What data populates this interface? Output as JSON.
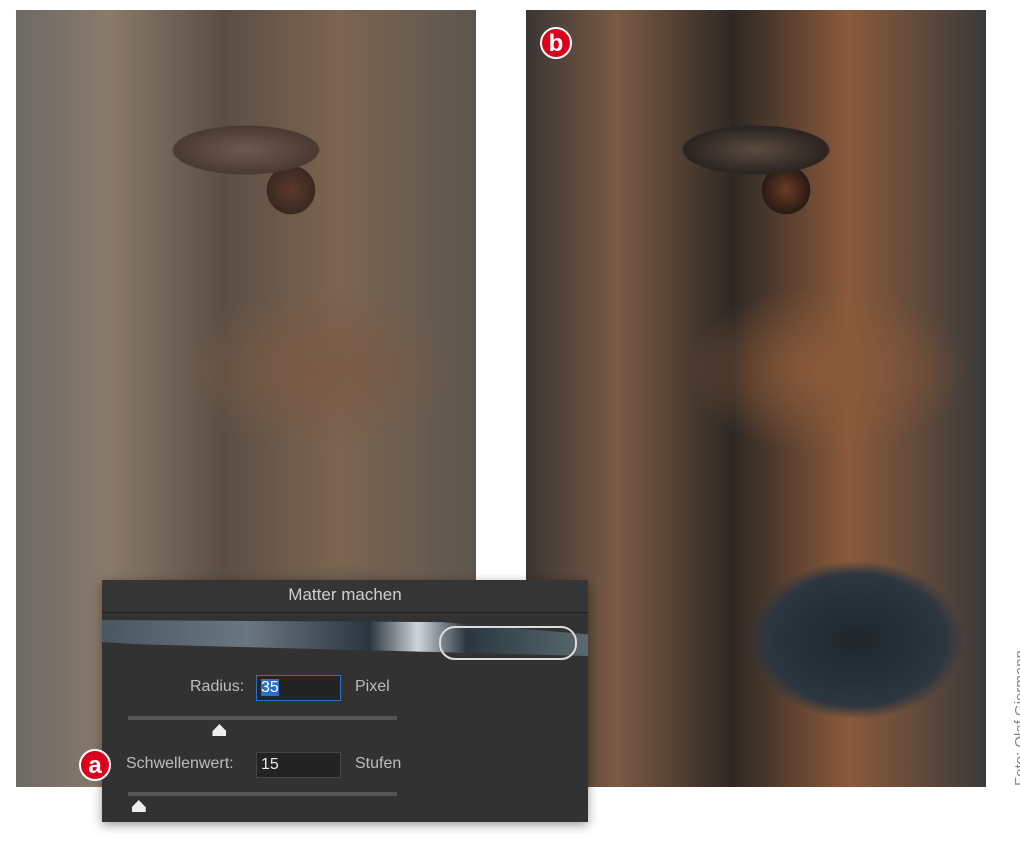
{
  "badges": {
    "a": "a",
    "b": "b"
  },
  "credit": "Foto: Olaf Giermann",
  "dialog": {
    "title": "Matter machen",
    "radius": {
      "label": "Radius:",
      "value": "35",
      "unit": "Pixel",
      "slider_fraction": 0.34
    },
    "threshold": {
      "label": "Schwellenwert:",
      "value": "15",
      "unit": "Stufen",
      "slider_fraction": 0.04
    }
  },
  "colors": {
    "badge": "#d9001b",
    "dialog_bg": "#323232",
    "focus": "#2c6fc9"
  }
}
